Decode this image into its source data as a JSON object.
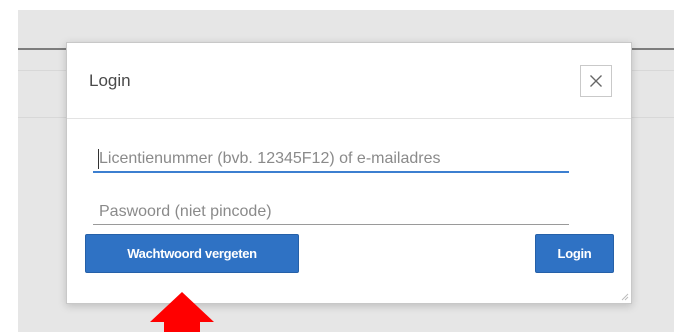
{
  "modal": {
    "title": "Login",
    "close_label": "×",
    "license_field": {
      "value": "",
      "placeholder": "Licentienummer (bvb. 12345F12) of e-mailadres"
    },
    "password_field": {
      "value": "",
      "placeholder": "Paswoord (niet pincode)"
    },
    "forgot_button_label": "Wachtwoord vergeten",
    "login_button_label": "Login"
  },
  "colors": {
    "primary": "#2f72c4",
    "focus_underline": "#3c7fd0",
    "annotation_arrow": "#ff0000"
  },
  "icons": {
    "close": "close-icon",
    "annotation": "arrow-up-icon"
  }
}
